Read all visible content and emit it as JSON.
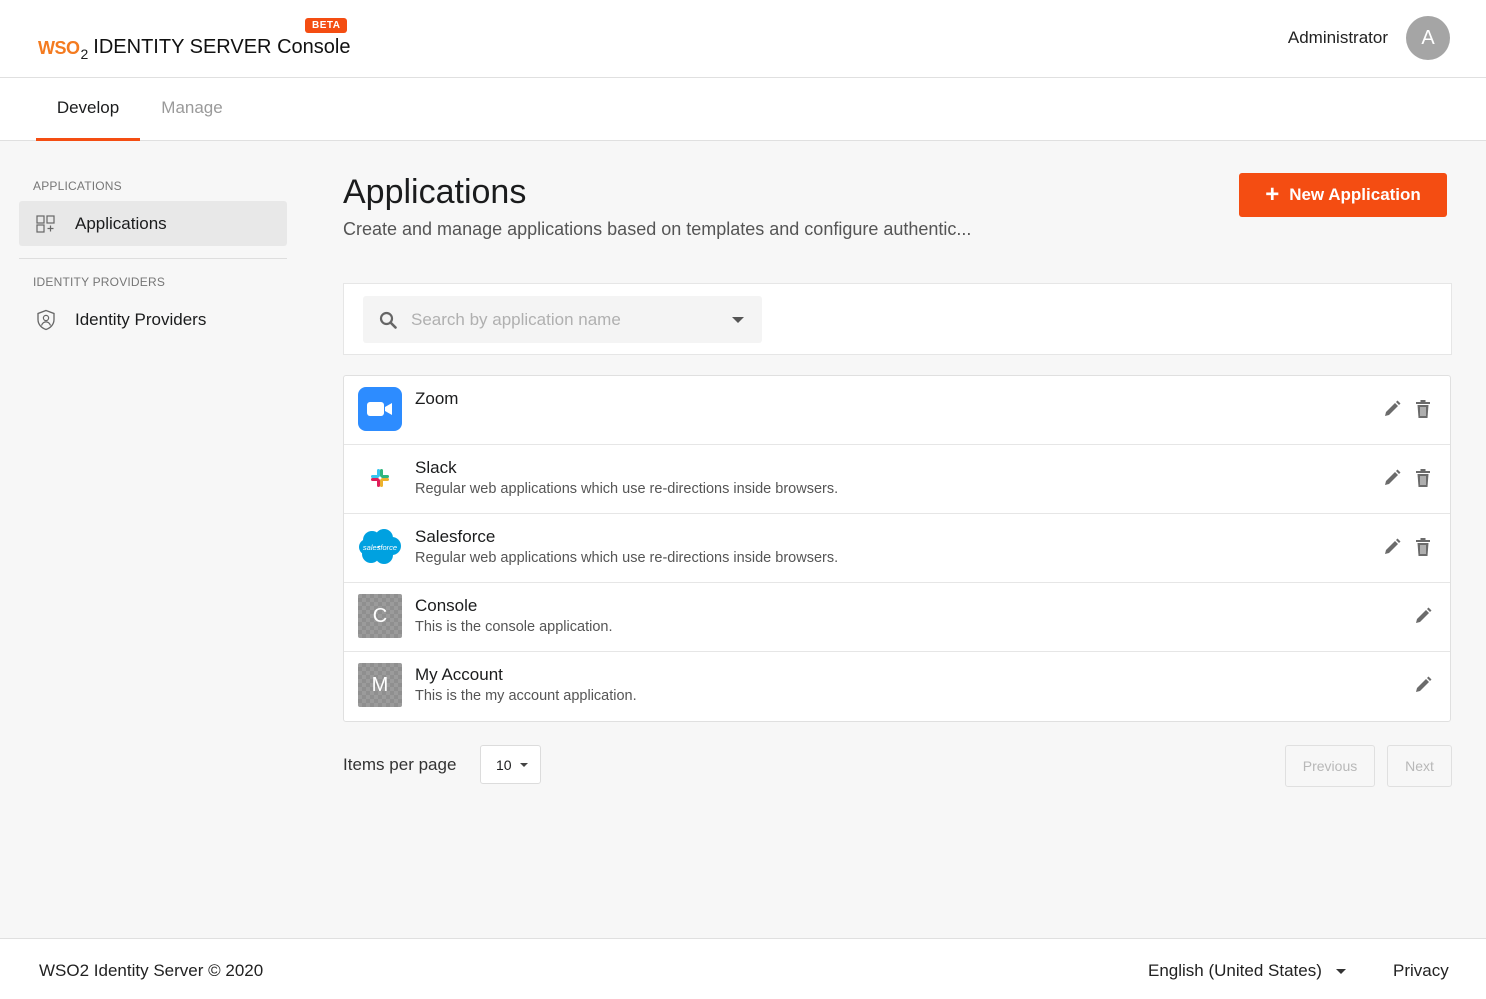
{
  "header": {
    "logo_wso": "WSO",
    "logo_two": "2",
    "logo_product_bold": "IDENTITY SERVER",
    "logo_product": "Console",
    "badge": "BETA",
    "user_name": "Administrator",
    "avatar_letter": "A"
  },
  "tabs": [
    {
      "label": "Develop",
      "active": true
    },
    {
      "label": "Manage",
      "active": false
    }
  ],
  "sidebar": {
    "sections": [
      {
        "heading": "APPLICATIONS",
        "item": {
          "label": "Applications",
          "icon": "applications-grid-icon",
          "active": true
        }
      },
      {
        "heading": "IDENTITY PROVIDERS",
        "item": {
          "label": "Identity Providers",
          "icon": "shield-user-icon",
          "active": false
        }
      }
    ]
  },
  "main": {
    "title": "Applications",
    "subtitle": "Create and manage applications based on templates and configure authentic...",
    "new_button": "New Application",
    "search_placeholder": "Search by application name"
  },
  "applications": [
    {
      "name": "Zoom",
      "description": "",
      "logo": "zoom-icon",
      "editable": true,
      "deletable": true
    },
    {
      "name": "Slack",
      "description": "Regular web applications which use re-directions inside browsers.",
      "logo": "slack-icon",
      "editable": true,
      "deletable": true
    },
    {
      "name": "Salesforce",
      "description": "Regular web applications which use re-directions inside browsers.",
      "logo": "salesforce-icon",
      "logo_text": "salesforce",
      "editable": true,
      "deletable": true
    },
    {
      "name": "Console",
      "description": "This is the console application.",
      "logo_letter": "C",
      "editable": true,
      "deletable": false
    },
    {
      "name": "My Account",
      "description": "This is the my account application.",
      "logo_letter": "M",
      "editable": true,
      "deletable": false
    }
  ],
  "pagination": {
    "items_per_page_label": "Items per page",
    "items_per_page_value": "10",
    "previous": "Previous",
    "next": "Next"
  },
  "footer": {
    "copyright": "WSO2 Identity Server © 2020",
    "language": "English (United States)",
    "privacy": "Privacy"
  },
  "colors": {
    "accent": "#f44d12",
    "zoom": "#2d8cff",
    "salesforce": "#00a1e0"
  }
}
